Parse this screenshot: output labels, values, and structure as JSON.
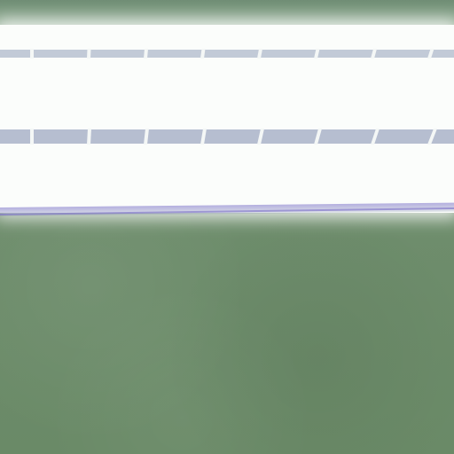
{
  "scene": {
    "subject": "fluorescent-light-fixture",
    "colors": {
      "wall": "#6e8d6c",
      "fixture_glow": "#fbfdfb",
      "louver_shadow": "#a9b3c8",
      "edge_tint": "#7a6ec8"
    },
    "louver_rows": 2,
    "louver_cells_per_row": 8
  }
}
